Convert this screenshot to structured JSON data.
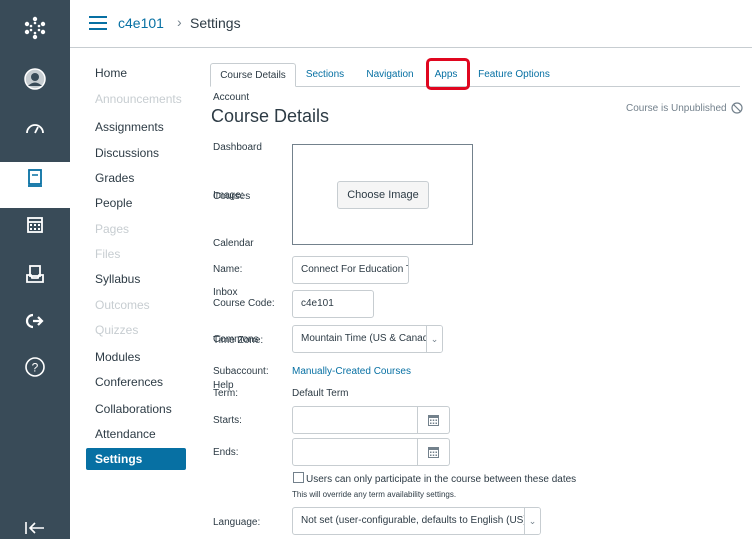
{
  "global_nav": {
    "items": [
      {
        "label": "Account",
        "icon": "account-icon"
      },
      {
        "label": "Dashboard",
        "icon": "dashboard-icon"
      },
      {
        "label": "Courses",
        "icon": "courses-icon"
      },
      {
        "label": "Calendar",
        "icon": "calendar-icon"
      },
      {
        "label": "Inbox",
        "icon": "inbox-icon"
      },
      {
        "label": "Commons",
        "icon": "commons-icon"
      },
      {
        "label": "Help",
        "icon": "help-icon"
      }
    ]
  },
  "breadcrumb": {
    "course": "c4e101",
    "separator": "›",
    "current": "Settings"
  },
  "course_nav": {
    "items": [
      {
        "label": "Home"
      },
      {
        "label": "Announcements"
      },
      {
        "label": "Assignments"
      },
      {
        "label": "Discussions"
      },
      {
        "label": "Grades"
      },
      {
        "label": "People"
      },
      {
        "label": "Pages"
      },
      {
        "label": "Files"
      },
      {
        "label": "Syllabus"
      },
      {
        "label": "Outcomes"
      },
      {
        "label": "Quizzes"
      },
      {
        "label": "Modules"
      },
      {
        "label": "Conferences"
      },
      {
        "label": "Collaborations"
      },
      {
        "label": "Attendance"
      },
      {
        "label": "Settings"
      }
    ]
  },
  "tabs": [
    {
      "label": "Course Details"
    },
    {
      "label": "Sections"
    },
    {
      "label": "Navigation"
    },
    {
      "label": "Apps"
    },
    {
      "label": "Feature Options"
    }
  ],
  "page_title": "Course Details",
  "status": "Course is Unpublished",
  "form": {
    "image_label": "Image:",
    "choose_image": "Choose Image",
    "name_label": "Name:",
    "name_value": "Connect For Education Training",
    "code_label": "Course Code:",
    "code_value": "c4e101",
    "tz_label": "Time Zone:",
    "tz_value": "Mountain Time (US & Canada)",
    "subaccount_label": "Subaccount:",
    "subaccount_value": "Manually-Created Courses",
    "term_label": "Term:",
    "term_value": "Default Term",
    "starts_label": "Starts:",
    "ends_label": "Ends:",
    "restrict_label": "Users can only participate in the course between these dates",
    "restrict_note": "This will override any term availability settings.",
    "language_label": "Language:",
    "language_value": "Not set (user-configurable, defaults to English (US))"
  },
  "colors": {
    "nav_bg": "#394b58",
    "accent": "#0770a3",
    "highlight": "#e0061f"
  }
}
